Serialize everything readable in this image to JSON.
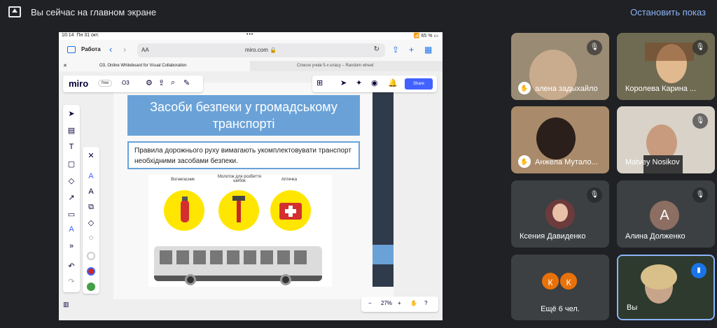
{
  "topbar": {
    "message": "Вы сейчас на главном экране",
    "stop": "Остановить показ"
  },
  "ipad": {
    "time": "10:14",
    "date": "Пн 31 окт.",
    "battery": "65 %",
    "browser": {
      "group": "Работа",
      "aa": "AA",
      "host": "miro.com 🔒"
    },
    "tabs": [
      "O3, Online Whiteboard for Visual Collaboration",
      "Список учнів 5-х класу – Random wheel"
    ]
  },
  "miro": {
    "logo": "miro",
    "plan": "free",
    "board": "O3",
    "share": "Share",
    "zoom": "27%",
    "title": "Засоби безпеки у громадському транспорті",
    "rules": "Правила дорожнього руху вимагають укомплектовувати транспорт необхідними засобами безпеки.",
    "labels": [
      "Вогнегасник",
      "Молоток для розбиття шибок",
      "Аптечка"
    ]
  },
  "participants": [
    {
      "name": "алена задыхайло",
      "muted": true,
      "hand": true
    },
    {
      "name": "Королева Карина ...",
      "muted": true,
      "hand": false
    },
    {
      "name": "Анжела Мутало...",
      "muted": false,
      "hand": true
    },
    {
      "name": "Matvey Nosikov",
      "muted": true,
      "hand": false
    },
    {
      "name": "Ксения Давиденко",
      "muted": true,
      "hand": false
    },
    {
      "name": "Алина Долженко",
      "initial": "А",
      "muted": true,
      "hand": false
    },
    {
      "name": "Ещё 6 чел.",
      "initials": [
        "К",
        "К"
      ]
    },
    {
      "name": "Вы",
      "speaking": true
    }
  ],
  "colors": {
    "accent": "#8ab4f8",
    "tile": "#3c4043",
    "miro_blue": "#4262ff",
    "title_blue": "#6aa2d8"
  }
}
